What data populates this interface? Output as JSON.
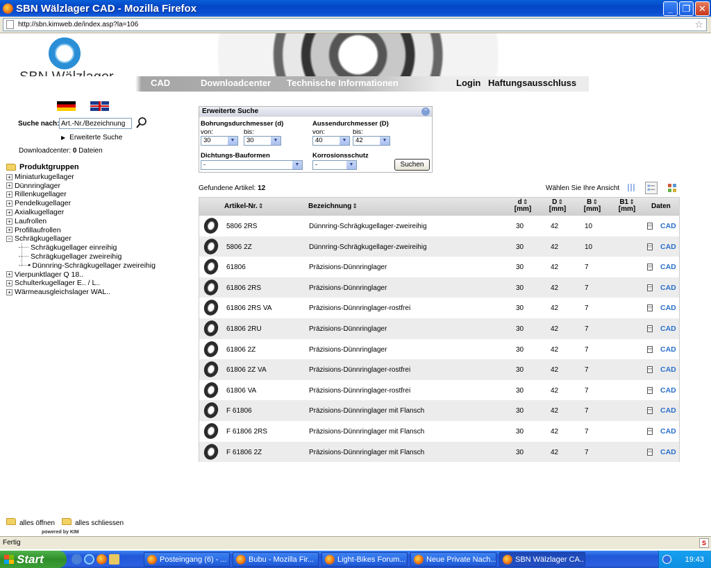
{
  "window": {
    "title": "SBN Wälzlager CAD - Mozilla Firefox",
    "url": "http://sbn.kimweb.de/index.asp?la=106"
  },
  "header": {
    "logo_text": "SBN Wälzlager",
    "nav": [
      "CAD",
      "Downloadcenter",
      "Technische Informationen",
      "Login",
      "Haftungsausschluss"
    ]
  },
  "sidebar": {
    "search_label": "Suche nach:",
    "search_value": "Art.-Nr./Bezeichnung",
    "advanced_search": "Erweiterte Suche",
    "downloadcenter_label": "Downloadcenter:",
    "downloadcenter_count": "0",
    "downloadcenter_unit": "Dateien",
    "tree": {
      "root": "Produktgruppen",
      "items": [
        "Miniaturkugellager",
        "Dünnringlager",
        "Rillenkugellager",
        "Pendelkugellager",
        "Axialkugellager",
        "Laufrollen",
        "Profillaufrollen",
        "Schrägkugellager",
        "Vierpunktlager Q 18..",
        "Schulterkugellager E.. / L..",
        "Wärmeausgleichslager WAL.."
      ],
      "children": [
        "Schrägkugellager einreihig",
        "Schrägkugellager zweireihig",
        "Dünnring-Schrägkugellager zweireihig"
      ]
    },
    "open_all": "alles öffnen",
    "close_all": "alles schliessen",
    "powered_by": "powered by KIM"
  },
  "advanced": {
    "title": "Erweiterte Suche",
    "bore_label": "Bohrungsdurchmesser (d)",
    "outer_label": "Aussendurchmesser (D)",
    "from_label": "von:",
    "to_label": "bis:",
    "bore_from": "30",
    "bore_to": "30",
    "outer_from": "40",
    "outer_to": "42",
    "seal_label": "Dichtungs-Bauformen",
    "seal_value": "-",
    "corrosion_label": "Korrosionsschutz",
    "corrosion_value": "-",
    "search_button": "Suchen"
  },
  "results": {
    "found_label": "Gefundene Artikel:",
    "found_count": "12",
    "view_label": "Wählen Sie Ihre Ansicht",
    "headers": {
      "article": "Artikel-Nr.",
      "description": "Bezeichnung",
      "d": "d",
      "D": "D",
      "B": "B",
      "B1": "B1",
      "unit": "[mm]",
      "data": "Daten"
    },
    "rows": [
      {
        "article": "5806 2RS",
        "description": "Dünnring-Schrägkugellager-zweireihig",
        "d": "30",
        "D": "42",
        "B": "10",
        "cad": "CAD"
      },
      {
        "article": "5806 2Z",
        "description": "Dünnring-Schrägkugellager-zweireihig",
        "d": "30",
        "D": "42",
        "B": "10",
        "cad": "CAD"
      },
      {
        "article": "61806",
        "description": "Präzisions-Dünnringlager",
        "d": "30",
        "D": "42",
        "B": "7",
        "cad": "CAD"
      },
      {
        "article": "61806 2RS",
        "description": "Präzisions-Dünnringlager",
        "d": "30",
        "D": "42",
        "B": "7",
        "cad": "CAD"
      },
      {
        "article": "61806 2RS VA",
        "description": "Präzisions-Dünnringlager-rostfrei",
        "d": "30",
        "D": "42",
        "B": "7",
        "cad": "CAD"
      },
      {
        "article": "61806 2RU",
        "description": "Präzisions-Dünnringlager",
        "d": "30",
        "D": "42",
        "B": "7",
        "cad": "CAD"
      },
      {
        "article": "61806 2Z",
        "description": "Präzisions-Dünnringlager",
        "d": "30",
        "D": "42",
        "B": "7",
        "cad": "CAD"
      },
      {
        "article": "61806 2Z VA",
        "description": "Präzisions-Dünnringlager-rostfrei",
        "d": "30",
        "D": "42",
        "B": "7",
        "cad": "CAD"
      },
      {
        "article": "61806 VA",
        "description": "Präzisions-Dünnringlager-rostfrei",
        "d": "30",
        "D": "42",
        "B": "7",
        "cad": "CAD"
      },
      {
        "article": "F 61806",
        "description": "Präzisions-Dünnringlager mit Flansch",
        "d": "30",
        "D": "42",
        "B": "7",
        "cad": "CAD"
      },
      {
        "article": "F 61806 2RS",
        "description": "Präzisions-Dünnringlager mit Flansch",
        "d": "30",
        "D": "42",
        "B": "7",
        "cad": "CAD"
      },
      {
        "article": "F 61806 2Z",
        "description": "Präzisions-Dünnringlager mit Flansch",
        "d": "30",
        "D": "42",
        "B": "7",
        "cad": "CAD"
      }
    ]
  },
  "statusbar": {
    "text": "Fertig"
  },
  "taskbar": {
    "start": "Start",
    "tasks": [
      "Posteingang (6) - ...",
      "Bubu - Mozilla Fir...",
      "Light-Bikes Forum...",
      "Neue Private Nach...",
      "SBN Wälzlager CA..."
    ],
    "clock": "19:43"
  },
  "colors": {
    "accent": "#2a70c9",
    "logo": "#2a8fd6"
  }
}
